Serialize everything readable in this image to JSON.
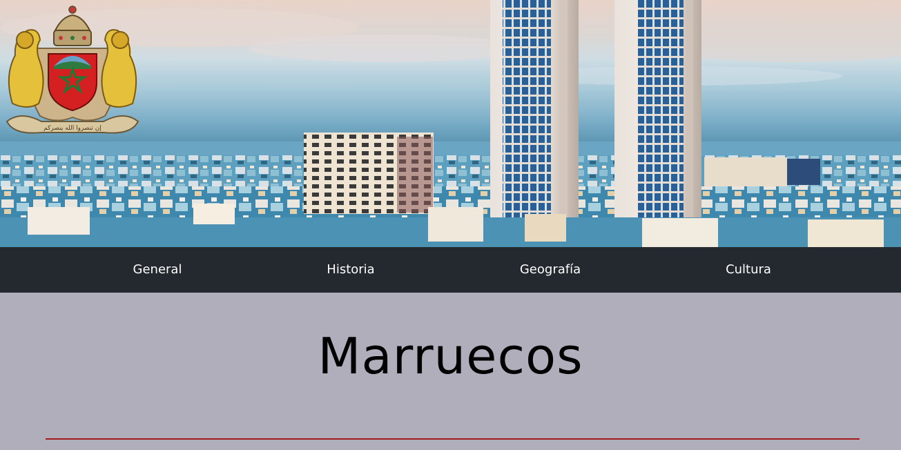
{
  "nav": {
    "items": [
      {
        "label": "General"
      },
      {
        "label": "Historia"
      },
      {
        "label": "Geografía"
      },
      {
        "label": "Cultura"
      }
    ]
  },
  "main": {
    "title": "Marruecos"
  },
  "colors": {
    "nav_background": "#23292f",
    "page_background": "#afaeba",
    "divider": "#9f1b1b",
    "nav_text": "#ffffff"
  },
  "hero": {
    "image": "city-skyline-with-twin-towers",
    "emblem": "coat-of-arms-of-morocco",
    "emblem_inscription": "إن تنصروا الله ينصركم"
  }
}
